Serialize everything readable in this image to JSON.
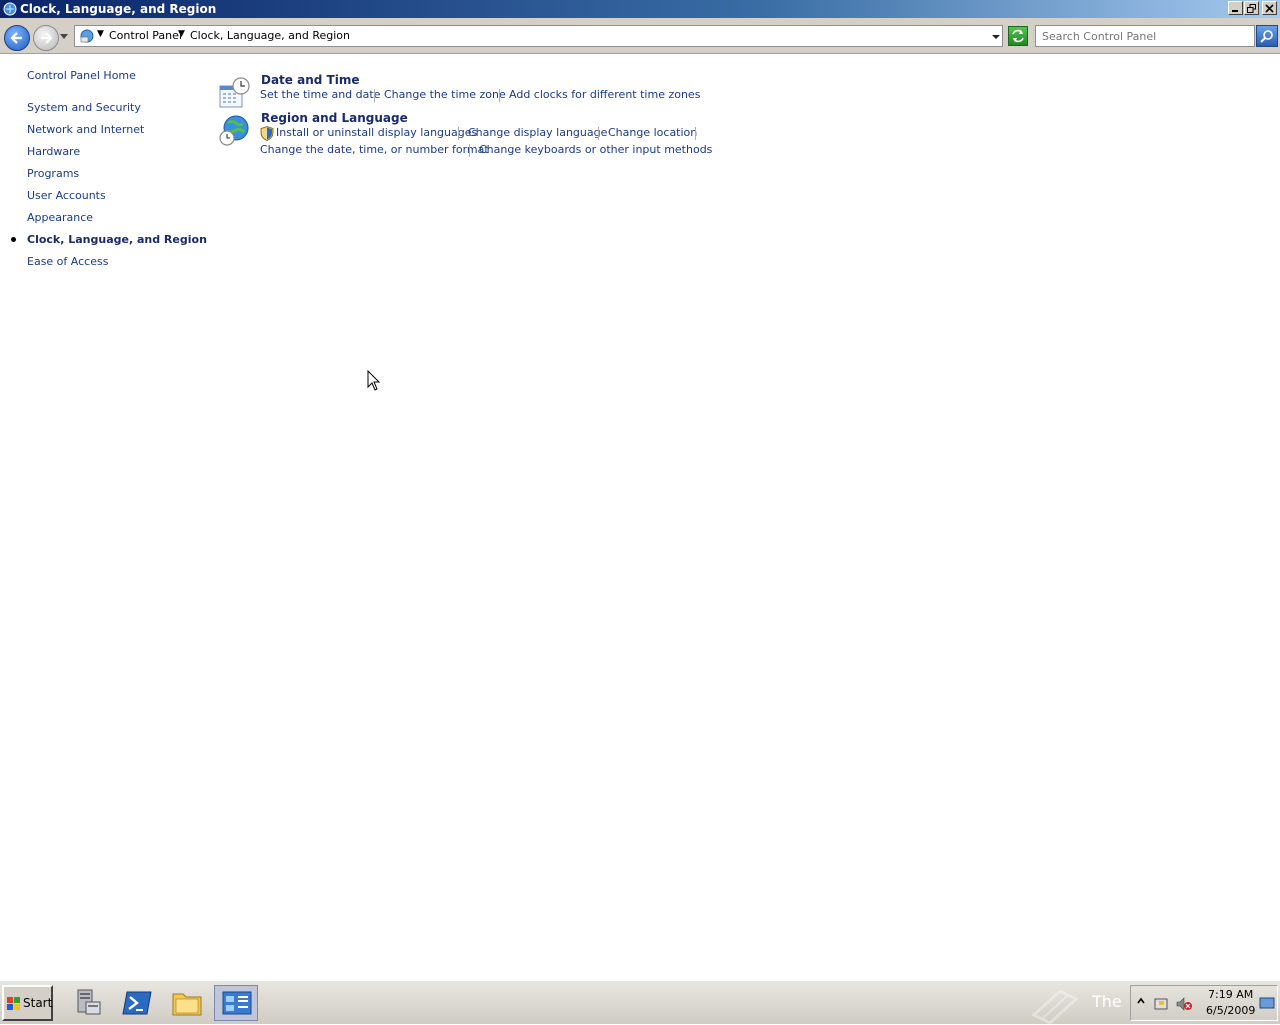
{
  "window": {
    "title": "Clock, Language, and Region",
    "icon": "control-panel-icon"
  },
  "address": {
    "crumbs": [
      "Control Panel",
      "Clock, Language, and Region"
    ],
    "search_placeholder": "Search Control Panel"
  },
  "sidebar": {
    "home": "Control Panel Home",
    "items": [
      {
        "label": "System and Security"
      },
      {
        "label": "Network and Internet"
      },
      {
        "label": "Hardware"
      },
      {
        "label": "Programs"
      },
      {
        "label": "User Accounts"
      },
      {
        "label": "Appearance"
      },
      {
        "label": "Clock, Language, and Region",
        "active": true
      },
      {
        "label": "Ease of Access"
      }
    ]
  },
  "categories": [
    {
      "title": "Date and Time",
      "icon": "calendar-clock-icon",
      "tasks": [
        "Set the time and date",
        "Change the time zone",
        "Add clocks for different time zones"
      ]
    },
    {
      "title": "Region and Language",
      "icon": "globe-clock-icon",
      "tasks": [
        "Install or uninstall display languages",
        "Change display language",
        "Change location",
        "Change the date, time, or number format",
        "Change keyboards or other input methods"
      ]
    }
  ],
  "taskbar": {
    "start_label": "Start",
    "watermark_text": "The Collection Book",
    "clock_time": "7:19 AM",
    "clock_date": "6/5/2009"
  },
  "colors": {
    "link": "#1a3a8a",
    "heading": "#1a2a6a",
    "titlebar": "#0a246a"
  }
}
